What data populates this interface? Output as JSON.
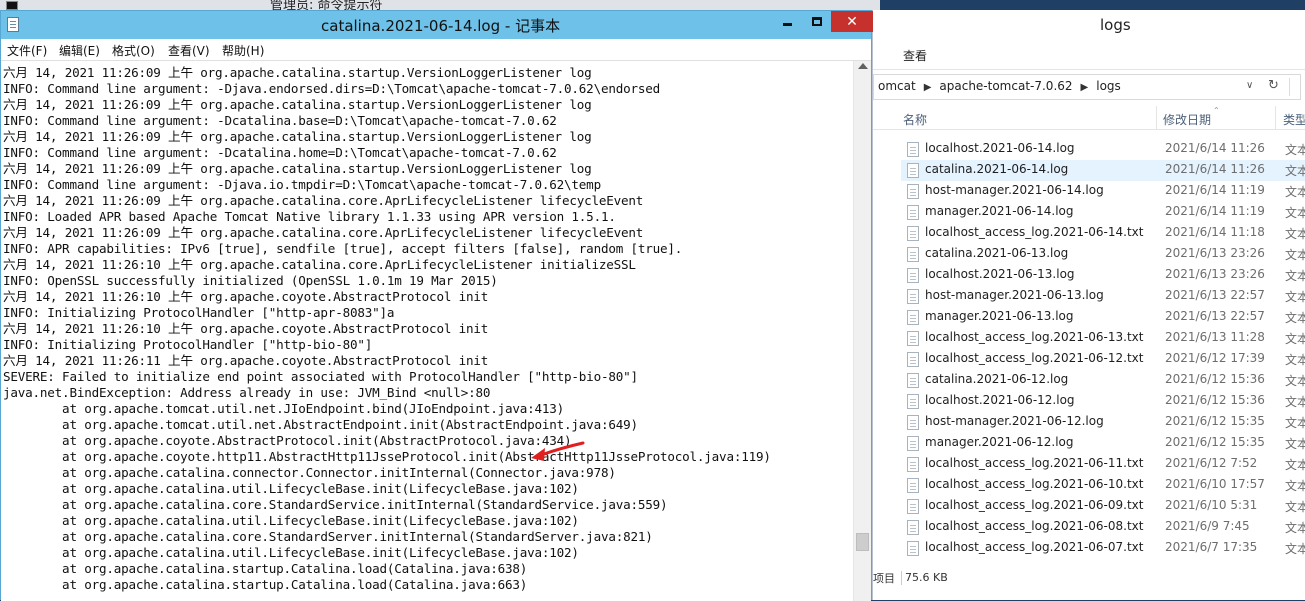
{
  "background_window": {
    "title": "管理员: 命令提示符"
  },
  "notepad": {
    "title": "catalina.2021-06-14.log - 记事本",
    "menu": [
      "文件(F)",
      "编辑(E)",
      "格式(O)",
      "查看(V)",
      "帮助(H)"
    ],
    "lines": [
      "六月 14, 2021 11:26:09 上午 org.apache.catalina.startup.VersionLoggerListener log",
      "INFO: Command line argument: -Djava.endorsed.dirs=D:\\Tomcat\\apache-tomcat-7.0.62\\endorsed",
      "六月 14, 2021 11:26:09 上午 org.apache.catalina.startup.VersionLoggerListener log",
      "INFO: Command line argument: -Dcatalina.base=D:\\Tomcat\\apache-tomcat-7.0.62",
      "六月 14, 2021 11:26:09 上午 org.apache.catalina.startup.VersionLoggerListener log",
      "INFO: Command line argument: -Dcatalina.home=D:\\Tomcat\\apache-tomcat-7.0.62",
      "六月 14, 2021 11:26:09 上午 org.apache.catalina.startup.VersionLoggerListener log",
      "INFO: Command line argument: -Djava.io.tmpdir=D:\\Tomcat\\apache-tomcat-7.0.62\\temp",
      "六月 14, 2021 11:26:09 上午 org.apache.catalina.core.AprLifecycleListener lifecycleEvent",
      "INFO: Loaded APR based Apache Tomcat Native library 1.1.33 using APR version 1.5.1.",
      "六月 14, 2021 11:26:09 上午 org.apache.catalina.core.AprLifecycleListener lifecycleEvent",
      "INFO: APR capabilities: IPv6 [true], sendfile [true], accept filters [false], random [true].",
      "六月 14, 2021 11:26:10 上午 org.apache.catalina.core.AprLifecycleListener initializeSSL",
      "INFO: OpenSSL successfully initialized (OpenSSL 1.0.1m 19 Mar 2015)",
      "六月 14, 2021 11:26:10 上午 org.apache.coyote.AbstractProtocol init",
      "INFO: Initializing ProtocolHandler [\"http-apr-8083\"]a",
      "六月 14, 2021 11:26:10 上午 org.apache.coyote.AbstractProtocol init",
      "INFO: Initializing ProtocolHandler [\"http-bio-80\"]",
      "六月 14, 2021 11:26:11 上午 org.apache.coyote.AbstractProtocol init",
      "SEVERE: Failed to initialize end point associated with ProtocolHandler [\"http-bio-80\"]",
      "java.net.BindException: Address already in use: JVM_Bind <null>:80",
      "        at org.apache.tomcat.util.net.JIoEndpoint.bind(JIoEndpoint.java:413)",
      "        at org.apache.tomcat.util.net.AbstractEndpoint.init(AbstractEndpoint.java:649)",
      "        at org.apache.coyote.AbstractProtocol.init(AbstractProtocol.java:434)",
      "        at org.apache.coyote.http11.AbstractHttp11JsseProtocol.init(AbstractHttp11JsseProtocol.java:119)",
      "        at org.apache.catalina.connector.Connector.initInternal(Connector.java:978)",
      "        at org.apache.catalina.util.LifecycleBase.init(LifecycleBase.java:102)",
      "        at org.apache.catalina.core.StandardService.initInternal(StandardService.java:559)",
      "        at org.apache.catalina.util.LifecycleBase.init(LifecycleBase.java:102)",
      "        at org.apache.catalina.core.StandardServer.initInternal(StandardServer.java:821)",
      "        at org.apache.catalina.util.LifecycleBase.init(LifecycleBase.java:102)",
      "        at org.apache.catalina.startup.Catalina.load(Catalina.java:638)",
      "        at org.apache.catalina.startup.Catalina.load(Catalina.java:663)"
    ],
    "annotation_color": "#e02020"
  },
  "explorer": {
    "title": "logs",
    "ribbon_tab": "查看",
    "address": [
      "omcat",
      "apache-tomcat-7.0.62",
      "logs"
    ],
    "columns": {
      "name": "名称",
      "date": "修改日期",
      "type": "类型"
    },
    "files": [
      {
        "name": "localhost.2021-06-14.log",
        "date": "2021/6/14 11:26",
        "type": "文本"
      },
      {
        "name": "catalina.2021-06-14.log",
        "date": "2021/6/14 11:26",
        "type": "文本",
        "selected": true
      },
      {
        "name": "host-manager.2021-06-14.log",
        "date": "2021/6/14 11:19",
        "type": "文本"
      },
      {
        "name": "manager.2021-06-14.log",
        "date": "2021/6/14 11:19",
        "type": "文本"
      },
      {
        "name": "localhost_access_log.2021-06-14.txt",
        "date": "2021/6/14 11:18",
        "type": "文本"
      },
      {
        "name": "catalina.2021-06-13.log",
        "date": "2021/6/13 23:26",
        "type": "文本"
      },
      {
        "name": "localhost.2021-06-13.log",
        "date": "2021/6/13 23:26",
        "type": "文本"
      },
      {
        "name": "host-manager.2021-06-13.log",
        "date": "2021/6/13 22:57",
        "type": "文本"
      },
      {
        "name": "manager.2021-06-13.log",
        "date": "2021/6/13 22:57",
        "type": "文本"
      },
      {
        "name": "localhost_access_log.2021-06-13.txt",
        "date": "2021/6/13 11:28",
        "type": "文本"
      },
      {
        "name": "localhost_access_log.2021-06-12.txt",
        "date": "2021/6/12 17:39",
        "type": "文本"
      },
      {
        "name": "catalina.2021-06-12.log",
        "date": "2021/6/12 15:36",
        "type": "文本"
      },
      {
        "name": "localhost.2021-06-12.log",
        "date": "2021/6/12 15:36",
        "type": "文本"
      },
      {
        "name": "host-manager.2021-06-12.log",
        "date": "2021/6/12 15:35",
        "type": "文本"
      },
      {
        "name": "manager.2021-06-12.log",
        "date": "2021/6/12 15:35",
        "type": "文本"
      },
      {
        "name": "localhost_access_log.2021-06-11.txt",
        "date": "2021/6/12 7:52",
        "type": "文本"
      },
      {
        "name": "localhost_access_log.2021-06-10.txt",
        "date": "2021/6/10 17:57",
        "type": "文本"
      },
      {
        "name": "localhost_access_log.2021-06-09.txt",
        "date": "2021/6/10 5:31",
        "type": "文本"
      },
      {
        "name": "localhost_access_log.2021-06-08.txt",
        "date": "2021/6/9 7:45",
        "type": "文本"
      },
      {
        "name": "localhost_access_log.2021-06-07.txt",
        "date": "2021/6/7 17:35",
        "type": "文本"
      }
    ],
    "status": {
      "count_label": "项目",
      "size": "75.6 KB"
    }
  }
}
